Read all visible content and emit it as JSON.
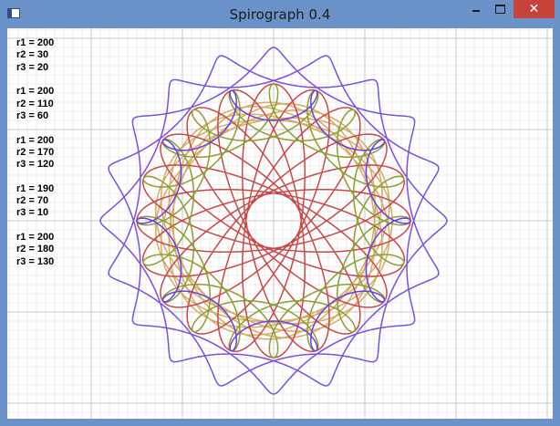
{
  "window": {
    "title": "Spirograph 0.4",
    "close_glyph": "✕"
  },
  "params": [
    {
      "r1": "r1 = 200",
      "r2": "r2 = 30",
      "r3": "r3 = 20",
      "color": "#7a50dd"
    },
    {
      "r1": "r1 = 200",
      "r2": "r2 = 110",
      "r3": "r3 = 60",
      "color": "#c84848"
    },
    {
      "r1": "r1 = 200",
      "r2": "r2 = 170",
      "r3": "r3 = 120",
      "color": "#8aa030"
    },
    {
      "r1": "r1 = 190",
      "r2": "r2 = 70",
      "r3": "r3 = 10",
      "color": "#d4ac66"
    },
    {
      "r1": "r1 = 200",
      "r2": "r2 = 180",
      "r3": "r3 = 130",
      "color": "#6a3fe0"
    }
  ],
  "colors": {
    "titlebar": "#6b93c9",
    "close_button": "#c7423a",
    "grid_minor": "#ececec",
    "grid_major": "#c8c8c8"
  }
}
